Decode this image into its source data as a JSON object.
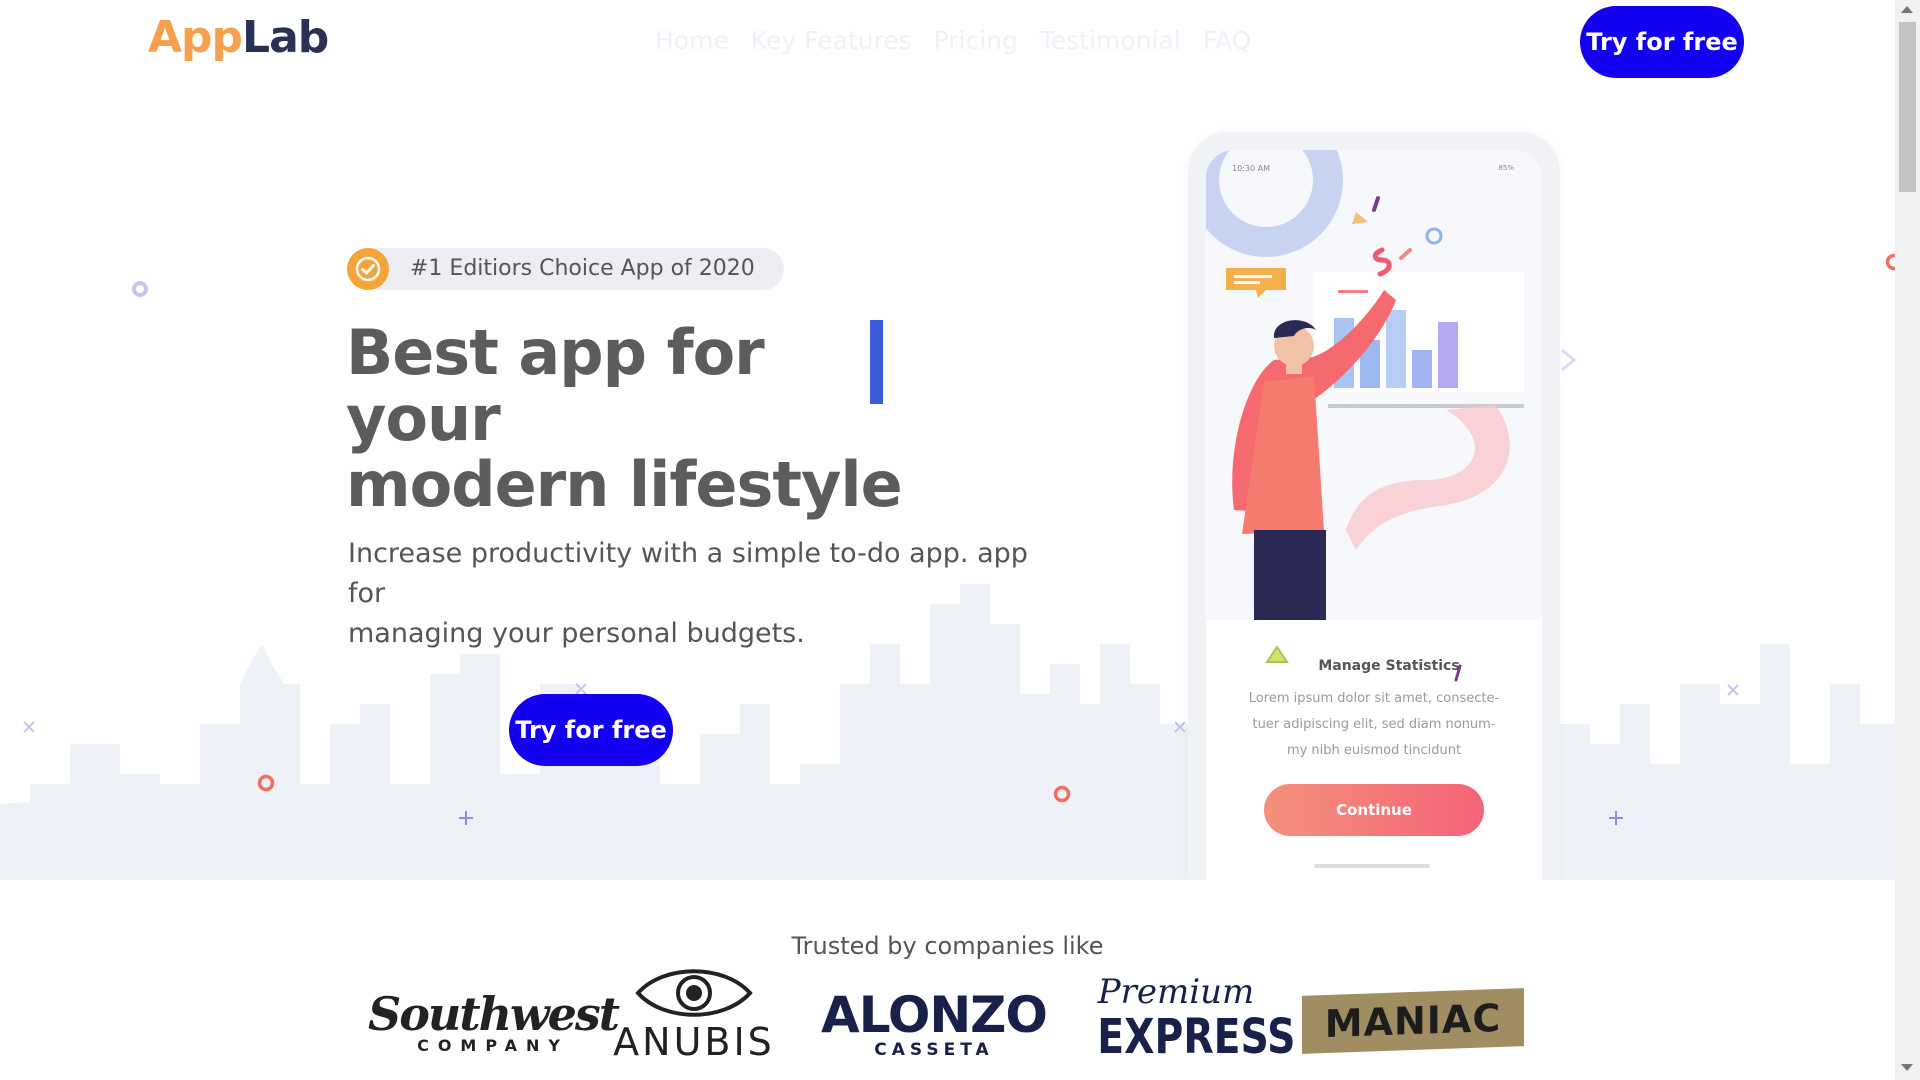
{
  "header": {
    "logo_part1": "App",
    "logo_part2": "Lab",
    "nav": [
      "Home",
      "Key Features",
      "Pricing",
      "Testimonial",
      "FAQ"
    ],
    "cta_label": "Try for free"
  },
  "hero": {
    "badge_text": "#1 Editiors Choice App of 2020",
    "title_line1": "Best app for your",
    "title_line2": "modern lifestyle",
    "subtitle_line1": "Increase productivity with a simple to-do app. app",
    "subtitle_line2": "for",
    "subtitle_line3": "managing your personal budgets.",
    "cta_label": "Try for free"
  },
  "phone": {
    "status_time": "10:30 AM",
    "status_battery": "85%",
    "card_title": "Manage Statistics",
    "card_body_line1": "Lorem ipsum dolor sit amet, consecte-",
    "card_body_line2": "tuer adipiscing elit, sed diam nonum-",
    "card_body_line3": "my nibh euismod tincidunt",
    "card_button": "Continue"
  },
  "trusted": {
    "heading": "Trusted by companies like",
    "brands": [
      {
        "name": "Southwest",
        "sub": "COMPANY"
      },
      {
        "name": "ANUBIS"
      },
      {
        "name": "ALONZO",
        "sub": "CASSETA"
      },
      {
        "name": "Premium",
        "sub": "EXPRESS"
      },
      {
        "name": "MANIAC"
      }
    ]
  },
  "colors": {
    "primary": "#1400f0",
    "logo_orange": "#f6a04d",
    "logo_navy": "#2a3157",
    "badge_icon": "#f5a43a",
    "cursor": "#3d5cd8",
    "card_button_gradient": [
      "#f4917c",
      "#f46377"
    ]
  }
}
